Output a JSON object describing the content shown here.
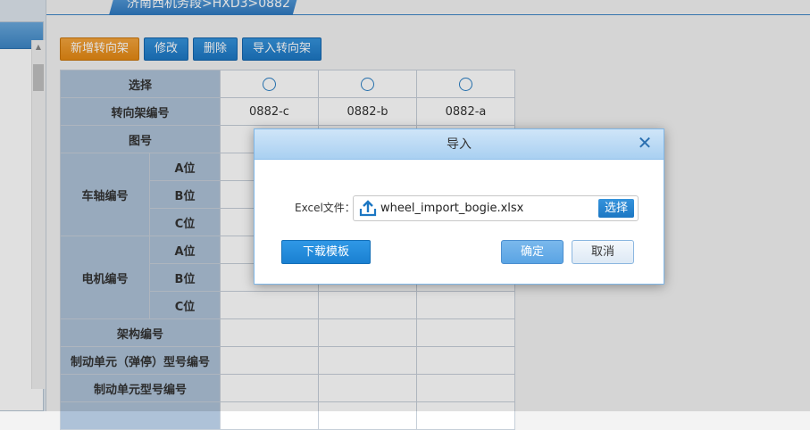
{
  "breadcrumb": "济南西机务段>HXD3>0882",
  "toolbar": {
    "add": "新增转向架",
    "edit": "修改",
    "delete": "删除",
    "import": "导入转向架"
  },
  "table": {
    "select_label": "选择",
    "bogie_no_label": "转向架编号",
    "drawing_no_label": "图号",
    "axle_group_label": "车轴编号",
    "motor_group_label": "电机编号",
    "pos_a": "A位",
    "pos_b": "B位",
    "pos_c": "C位",
    "frame_no_label": "架构编号",
    "brake_spring_label": "制动单元（弹停）型号编号",
    "brake_unit_label": "制动单元型号编号",
    "bogies": [
      "0882-c",
      "0882-b",
      "0882-a"
    ]
  },
  "dialog": {
    "title": "导入",
    "file_label": "Excel文件：",
    "file_name": "wheel_import_bogie.xlsx",
    "choose": "选择",
    "download_template": "下载模板",
    "ok": "确定",
    "cancel": "取消"
  },
  "colors": {
    "accent_blue": "#1c77c3",
    "accent_orange": "#e48812",
    "label_cell": "#aec2d8"
  }
}
